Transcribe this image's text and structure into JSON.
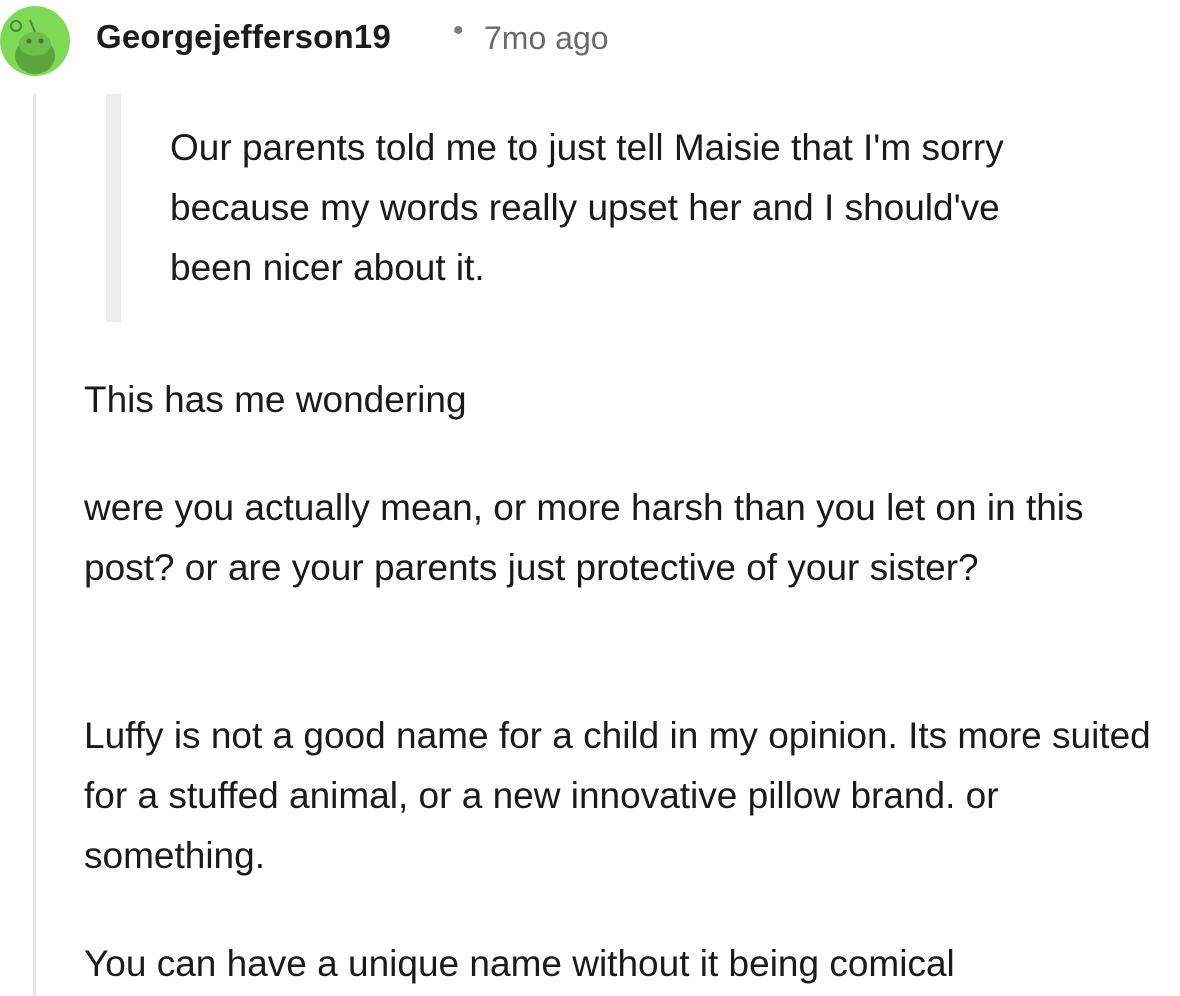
{
  "comment": {
    "author": "Georgejefferson19",
    "separator": "•",
    "age": "7mo ago",
    "avatar_icon": "snoo-avatar-icon",
    "avatar_color": "#7ed957",
    "quote": "Our parents told me to just tell Maisie that I'm sorry because my words really upset her and I should've been nicer about it.",
    "paragraphs": [
      "This has me wondering",
      "were you actually mean, or more harsh than you let on in this post? or are your parents just protective of your sister?",
      "Luffy is not a good name for a child in my opinion. Its more suited for a stuffed animal, or a new innovative pillow brand. or something.",
      "You can have a unique name without it being comical"
    ]
  }
}
